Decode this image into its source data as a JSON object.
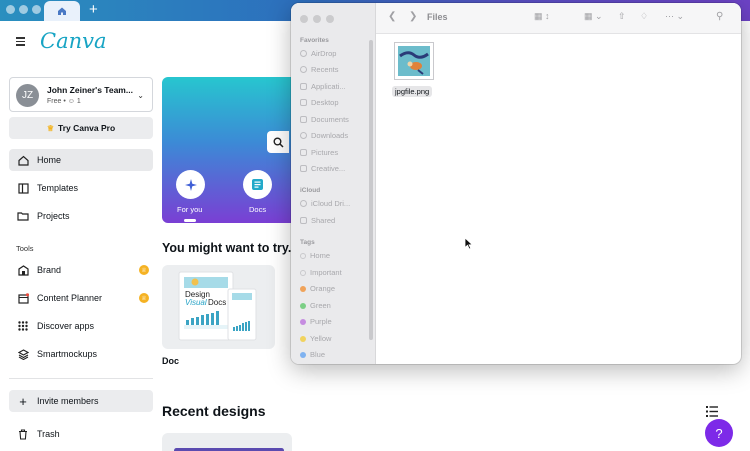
{
  "browser": {
    "new_tab_label": "+"
  },
  "canva": {
    "logo": "Canva",
    "team": {
      "initials": "JZ",
      "name": "John Zeiner's Team...",
      "plan": "Free",
      "members": "1"
    },
    "try_pro": "Try Canva Pro",
    "nav": [
      {
        "label": "Home",
        "icon": "home-icon",
        "active": true
      },
      {
        "label": "Templates",
        "icon": "templates-icon"
      },
      {
        "label": "Projects",
        "icon": "folder-icon"
      }
    ],
    "tools_label": "Tools",
    "tools": [
      {
        "label": "Brand",
        "icon": "brand-icon",
        "pro": true
      },
      {
        "label": "Content Planner",
        "icon": "calendar-icon",
        "pro": true
      },
      {
        "label": "Discover apps",
        "icon": "apps-grid-icon"
      },
      {
        "label": "Smartmockups",
        "icon": "layers-icon"
      }
    ],
    "invite_members": "Invite members",
    "trash": "Trash",
    "hero": {
      "for_you": "For you",
      "docs": "Docs"
    },
    "try_heading": "You might want to try...",
    "doc_card": {
      "label": "Doc",
      "title_line1": "Design",
      "title_line2": "Visual",
      "title_line3": "Docs"
    },
    "recent_heading": "Recent designs",
    "help": "?"
  },
  "finder": {
    "title": "Files",
    "sections": {
      "favorites": "Favorites",
      "icloud": "iCloud",
      "tags": "Tags"
    },
    "favorites": [
      "AirDrop",
      "Recents",
      "Applicati...",
      "Desktop",
      "Documents",
      "Downloads",
      "Pictures",
      "Creative..."
    ],
    "icloud": [
      "iCloud Dri...",
      "Shared"
    ],
    "tags": [
      {
        "label": "Home",
        "color": "#c9c9cc"
      },
      {
        "label": "Important",
        "color": "#c9c9cc"
      },
      {
        "label": "Orange",
        "color": "#f0a35a"
      },
      {
        "label": "Green",
        "color": "#7ccf86"
      },
      {
        "label": "Purple",
        "color": "#c58ce0"
      },
      {
        "label": "Yellow",
        "color": "#f1d35e"
      },
      {
        "label": "Blue",
        "color": "#7fb2f0"
      }
    ],
    "file": {
      "name": "jpgfile.png"
    }
  }
}
